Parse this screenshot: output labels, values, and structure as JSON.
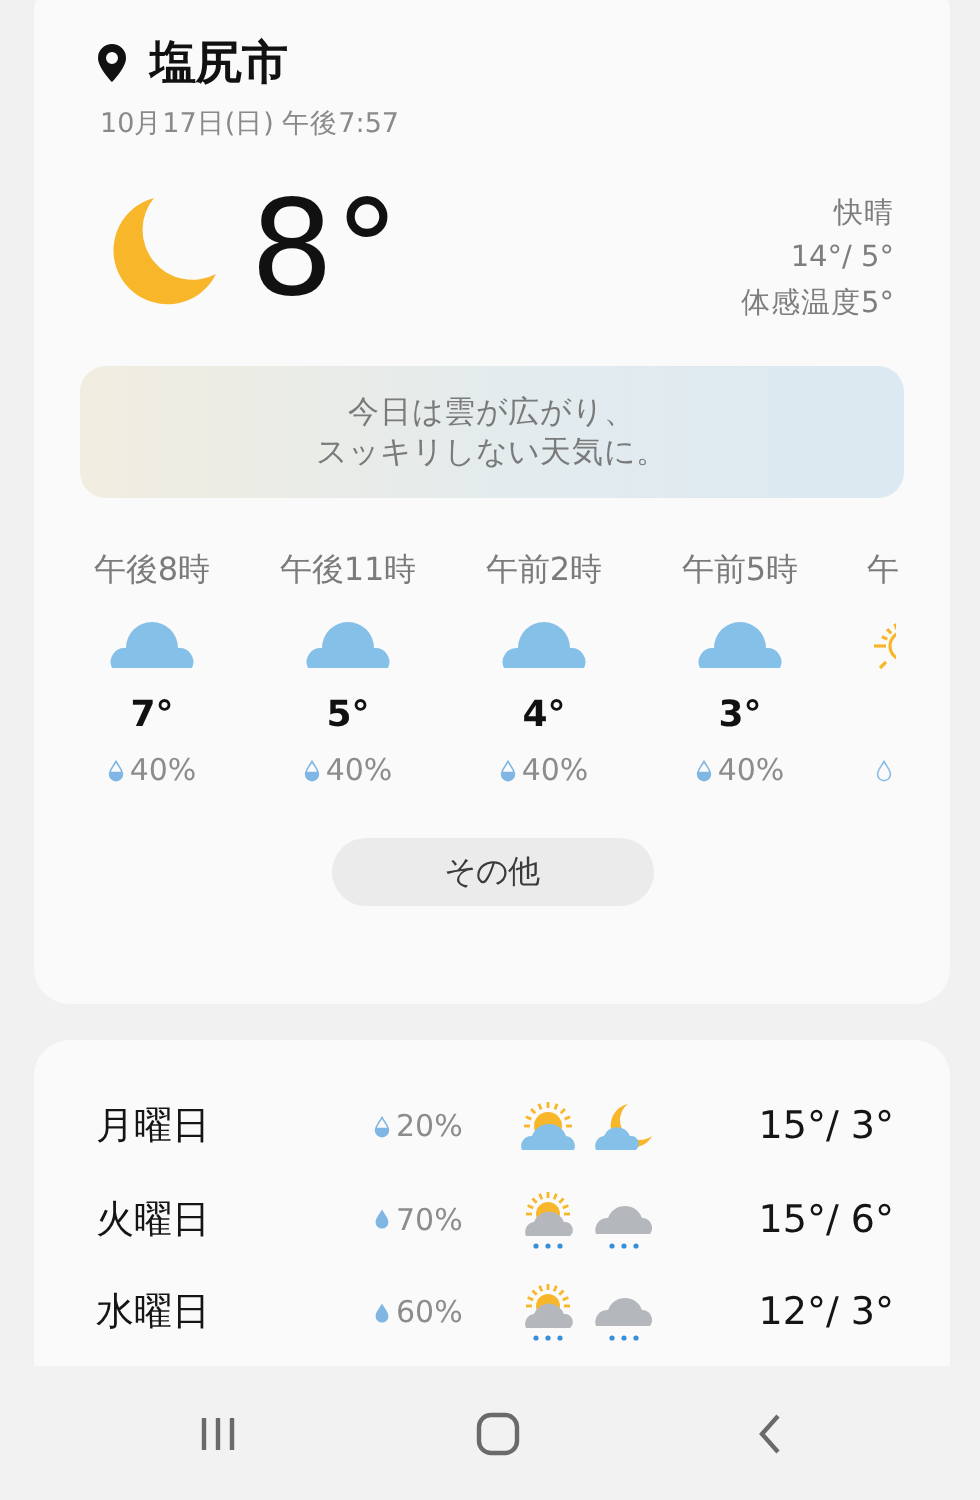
{
  "location": {
    "city": "塩尻市",
    "datetime": "10月17日(日) 午後7:57"
  },
  "current": {
    "icon": {
      "kind": "moon"
    },
    "temperature": "8°",
    "condition": "快晴",
    "high_low": "14°/ 5°",
    "feels_like": "体感温度5°"
  },
  "summary": [
    "今日は雲が広がり、",
    "スッキリしない天気に。"
  ],
  "hourly": [
    {
      "time": "午後8時",
      "icon": {
        "kind": "cloud"
      },
      "temperature": "7°",
      "drop": {
        "kind": "half"
      },
      "precip": "40%"
    },
    {
      "time": "午後11時",
      "icon": {
        "kind": "cloud"
      },
      "temperature": "5°",
      "drop": {
        "kind": "half"
      },
      "precip": "40%"
    },
    {
      "time": "午前2時",
      "icon": {
        "kind": "cloud"
      },
      "temperature": "4°",
      "drop": {
        "kind": "half"
      },
      "precip": "40%"
    },
    {
      "time": "午前5時",
      "icon": {
        "kind": "cloud"
      },
      "temperature": "3°",
      "drop": {
        "kind": "half"
      },
      "precip": "40%"
    },
    {
      "time": "午",
      "icon": {
        "kind": "sun-partial"
      },
      "drop": {
        "kind": "outline"
      }
    }
  ],
  "more_button": "その他",
  "daily": [
    {
      "day": "月曜日",
      "drop": {
        "kind": "half"
      },
      "precip": "20%",
      "icons": [
        {
          "kind": "sun-cloud"
        },
        {
          "kind": "moon-cloud"
        }
      ],
      "temps": "15°/ 3°"
    },
    {
      "day": "火曜日",
      "drop": {
        "kind": "full"
      },
      "precip": "70%",
      "icons": [
        {
          "kind": "sun-cloud-rain"
        },
        {
          "kind": "cloud-rain"
        }
      ],
      "temps": "15°/ 6°"
    },
    {
      "day": "水曜日",
      "drop": {
        "kind": "full"
      },
      "precip": "60%",
      "icons": [
        {
          "kind": "sun-cloud-rain"
        },
        {
          "kind": "cloud-rain"
        }
      ],
      "temps": "12°/ 3°"
    }
  ],
  "nav_bar": [
    {
      "kind": "recent"
    },
    {
      "kind": "home"
    },
    {
      "kind": "back"
    }
  ]
}
